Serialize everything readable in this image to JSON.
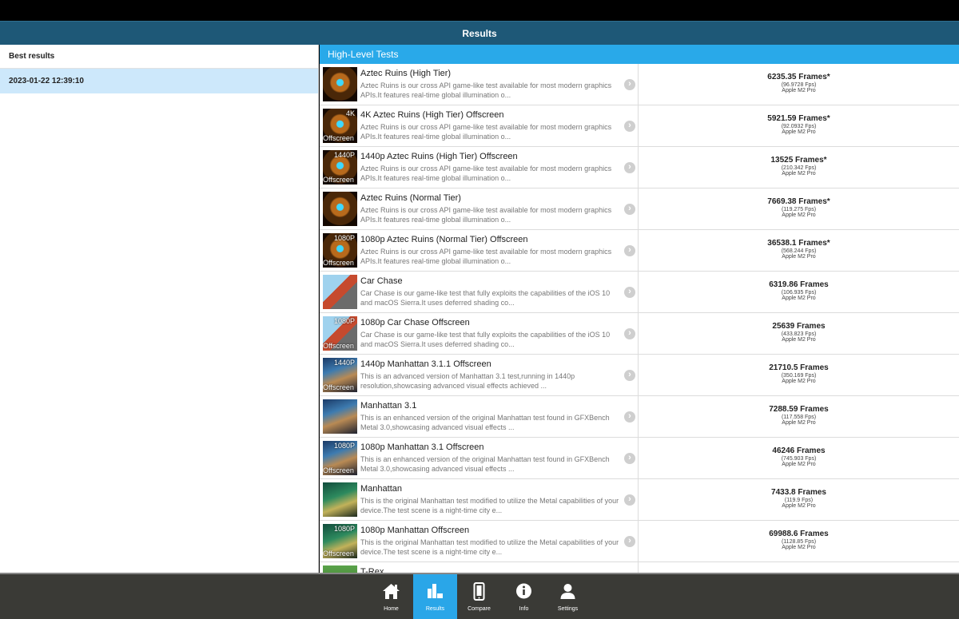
{
  "title": "Results",
  "left": {
    "header": "Best results",
    "entry": "2023-01-22 12:39:10"
  },
  "section": "High-Level Tests",
  "tests": [
    {
      "name": "Aztec Ruins (High Tier)",
      "desc": "Aztec Ruins is our cross API game-like test available for most modern graphics APIs.It features real-time global illumination o...",
      "frames": "6235.35 Frames*",
      "fps": "(96.9728 Fps)",
      "device": "Apple M2 Pro",
      "thumb": "aztec",
      "tag_top": "",
      "tag_bottom": ""
    },
    {
      "name": "4K Aztec Ruins (High Tier) Offscreen",
      "desc": "Aztec Ruins is our cross API game-like test available for most modern graphics APIs.It features real-time global illumination o...",
      "frames": "5921.59 Frames*",
      "fps": "(92.0932 Fps)",
      "device": "Apple M2 Pro",
      "thumb": "aztec",
      "tag_top": "4K",
      "tag_bottom": "Offscreen"
    },
    {
      "name": "1440p Aztec Ruins (High Tier) Offscreen",
      "desc": "Aztec Ruins is our cross API game-like test available for most modern graphics APIs.It features real-time global illumination o...",
      "frames": "13525 Frames*",
      "fps": "(210.342 Fps)",
      "device": "Apple M2 Pro",
      "thumb": "aztec",
      "tag_top": "1440P",
      "tag_bottom": "Offscreen"
    },
    {
      "name": "Aztec Ruins (Normal Tier)",
      "desc": "Aztec Ruins is our cross API game-like test available for most modern graphics APIs.It features real-time global illumination o...",
      "frames": "7669.38 Frames*",
      "fps": "(119.275 Fps)",
      "device": "Apple M2 Pro",
      "thumb": "aztec",
      "tag_top": "",
      "tag_bottom": ""
    },
    {
      "name": "1080p Aztec Ruins (Normal Tier) Offscreen",
      "desc": "Aztec Ruins is our cross API game-like test available for most modern graphics APIs.It features real-time global illumination o...",
      "frames": "36538.1 Frames*",
      "fps": "(568.244 Fps)",
      "device": "Apple M2 Pro",
      "thumb": "aztec",
      "tag_top": "1080P",
      "tag_bottom": "Offscreen"
    },
    {
      "name": "Car Chase",
      "desc": "Car Chase is our game-like test that fully exploits the capabilities of the iOS 10 and macOS Sierra.It uses deferred shading co...",
      "frames": "6319.86 Frames",
      "fps": "(106.935 Fps)",
      "device": "Apple M2 Pro",
      "thumb": "car",
      "tag_top": "",
      "tag_bottom": ""
    },
    {
      "name": "1080p Car Chase Offscreen",
      "desc": "Car Chase is our game-like test that fully exploits the capabilities of the iOS 10 and macOS Sierra.It uses deferred shading co...",
      "frames": "25639 Frames",
      "fps": "(433.823 Fps)",
      "device": "Apple M2 Pro",
      "thumb": "car",
      "tag_top": "1080P",
      "tag_bottom": "Offscreen"
    },
    {
      "name": "1440p Manhattan 3.1.1 Offscreen",
      "desc": "This is an advanced version of Manhattan 3.1 test,running in 1440p resolution,showcasing advanced visual effects achieved ...",
      "frames": "21710.5 Frames",
      "fps": "(350.169 Fps)",
      "device": "Apple M2 Pro",
      "thumb": "man",
      "tag_top": "1440P",
      "tag_bottom": "Offscreen"
    },
    {
      "name": "Manhattan 3.1",
      "desc": "This is an enhanced version of the original Manhattan test found in GFXBench Metal 3.0,showcasing advanced visual effects ...",
      "frames": "7288.59 Frames",
      "fps": "(117.558 Fps)",
      "device": "Apple M2 Pro",
      "thumb": "man",
      "tag_top": "",
      "tag_bottom": ""
    },
    {
      "name": "1080p Manhattan 3.1 Offscreen",
      "desc": "This is an enhanced version of the original Manhattan test found in GFXBench Metal 3.0,showcasing advanced visual effects ...",
      "frames": "46246 Frames",
      "fps": "(745.903 Fps)",
      "device": "Apple M2 Pro",
      "thumb": "man",
      "tag_top": "1080P",
      "tag_bottom": "Offscreen"
    },
    {
      "name": "Manhattan",
      "desc": "This is the original Manhattan test modified to utilize the Metal capabilities of your device.The test scene is a night-time city e...",
      "frames": "7433.8 Frames",
      "fps": "(119.9 Fps)",
      "device": "Apple M2 Pro",
      "thumb": "old",
      "tag_top": "",
      "tag_bottom": ""
    },
    {
      "name": "1080p Manhattan Offscreen",
      "desc": "This is the original Manhattan test modified to utilize the Metal capabilities of your device.The test scene is a night-time city e...",
      "frames": "69988.6 Frames",
      "fps": "(1128.85 Fps)",
      "device": "Apple M2 Pro",
      "thumb": "old",
      "tag_top": "1080P",
      "tag_bottom": "Offscreen"
    },
    {
      "name": "T-Rex",
      "desc": "",
      "frames": "",
      "fps": "",
      "device": "",
      "thumb": "trex",
      "tag_top": "",
      "tag_bottom": ""
    }
  ],
  "nav": [
    {
      "label": "Home",
      "icon": "home-icon",
      "active": false
    },
    {
      "label": "Results",
      "icon": "results-chart-icon",
      "active": true
    },
    {
      "label": "Compare",
      "icon": "phone-icon",
      "active": false
    },
    {
      "label": "Info",
      "icon": "info-icon",
      "active": false
    },
    {
      "label": "Settings",
      "icon": "user-icon",
      "active": false
    }
  ]
}
